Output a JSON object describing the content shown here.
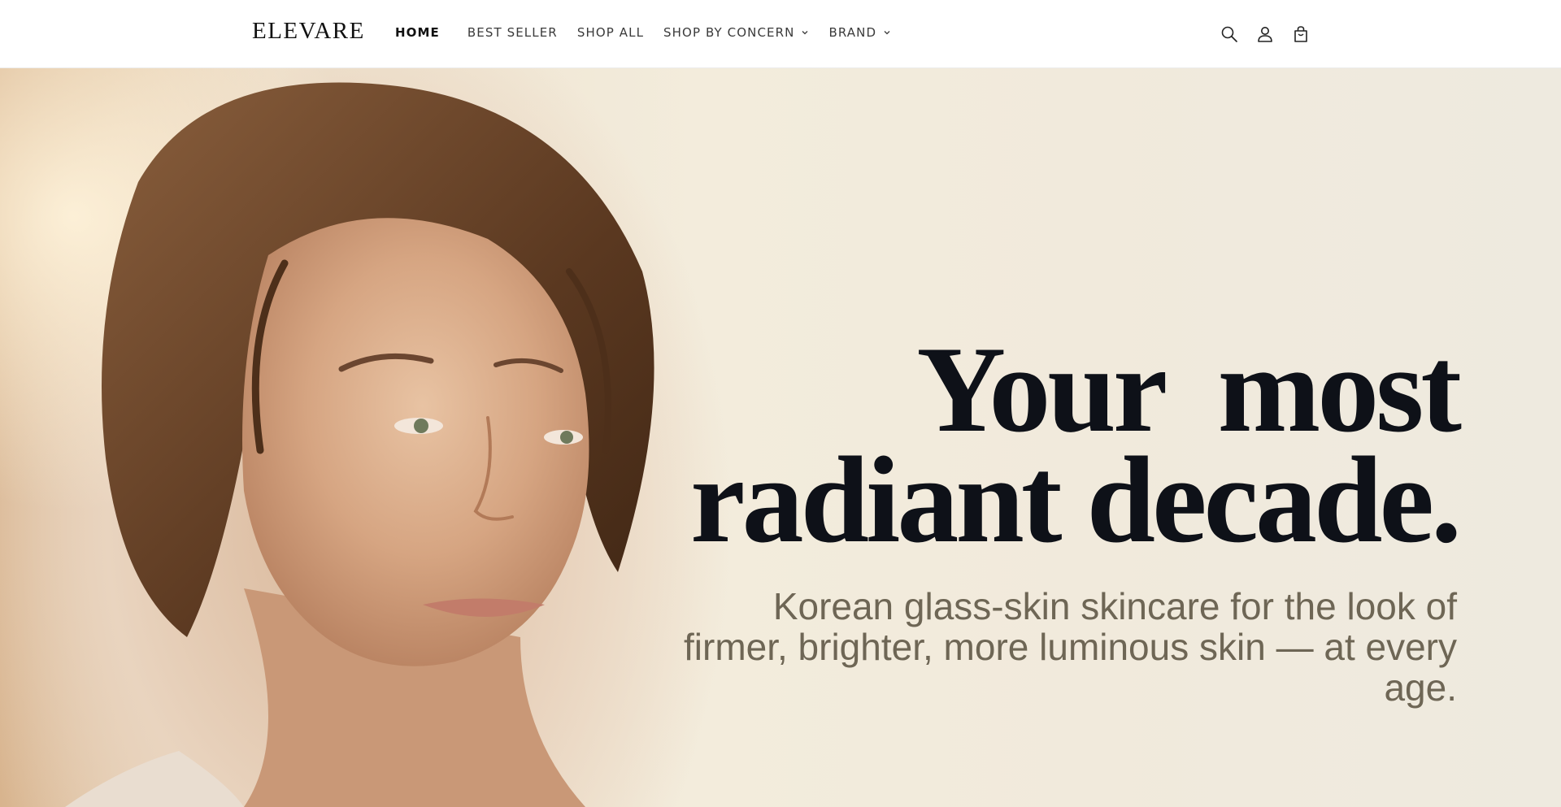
{
  "header": {
    "logo": "ELEVARE",
    "nav": [
      {
        "label": "HOME",
        "active": true
      },
      {
        "label": "BEST SELLER"
      },
      {
        "label": "SHOP ALL"
      },
      {
        "label": "SHOP BY CONCERN",
        "dropdown": true
      },
      {
        "label": "BRAND",
        "dropdown": true
      }
    ],
    "icons": [
      "search-icon",
      "account-icon",
      "cart-icon"
    ]
  },
  "hero": {
    "headline_line1": "Your  most",
    "headline_line2": "radiant decade.",
    "subhead_line1": "Korean glass-skin skincare for the look of",
    "subhead_line2": "firmer, brighter, more luminous skin — at every age."
  },
  "colors": {
    "header_bg": "#ffffff",
    "headline": "#0e1118",
    "subhead": "#6e6655",
    "hero_bg": "#f1eadc"
  }
}
